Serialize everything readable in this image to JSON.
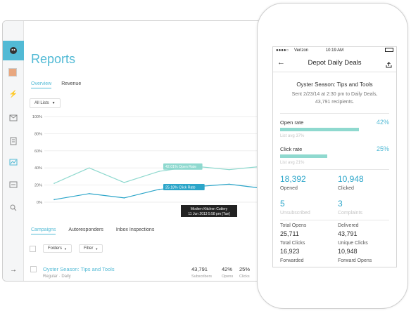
{
  "desktop": {
    "title": "Reports",
    "tabs": [
      "Overview",
      "Revenue"
    ],
    "list_filter": "All Lists",
    "sub_tabs": [
      "Campaigns",
      "Autoresponders",
      "Inbox Inspections"
    ],
    "folders_label": "Folders",
    "filter_label": "Filter",
    "campaign": {
      "name": "Oyster Season: Tips and Tools",
      "meta": "Regular · Daily",
      "subscribers": "43,791",
      "subscribers_label": "Subscribers",
      "opens": "42%",
      "opens_label": "Opens",
      "clicks": "25%",
      "clicks_label": "Clicks"
    }
  },
  "chart_data": {
    "type": "line",
    "y_ticks": [
      "100%",
      "80%",
      "60%",
      "40%",
      "20%",
      "0%"
    ],
    "ylim": [
      0,
      100
    ],
    "x": [
      1,
      2,
      3,
      4,
      5,
      6,
      7,
      8
    ],
    "series": [
      {
        "name": "Open Rate",
        "values": [
          22,
          40,
          23,
          36,
          42,
          38,
          42,
          42
        ]
      },
      {
        "name": "Click Rate",
        "values": [
          3,
          10,
          5,
          15,
          18,
          21,
          16,
          19
        ]
      }
    ],
    "annotations": {
      "open_label": "42.01% Open Rate",
      "click_label": "25.18% Click Rate",
      "tooltip_line1": "Modern Kitchen Cutlery",
      "tooltip_line2": "11 Jun 2013 5:58 pm [Tue]"
    },
    "colors": {
      "open": "#8fd9cf",
      "click": "#2ba5c9"
    }
  },
  "phone": {
    "status": {
      "carrier": "Verizon",
      "time": "10:19 AM"
    },
    "nav_title": "Depot Daily Deals",
    "campaign_title": "Oyster Season: Tips and Tools",
    "sent_line1": "Sent 2/23/14 at 2:30 pm to Daily Deals,",
    "sent_line2": "43,791 recipients.",
    "open_rate_label": "Open rate",
    "open_rate_value": "42%",
    "open_rate_fraction": 0.42,
    "open_avg": "List avg 37%",
    "click_rate_label": "Click rate",
    "click_rate_value": "25%",
    "click_rate_fraction": 0.25,
    "click_avg": "List avg 21%",
    "opened_value": "18,392",
    "opened_label": "Opened",
    "clicked_value": "10,948",
    "clicked_label": "Clicked",
    "unsub_value": "5",
    "unsub_label": "Unsubscribed",
    "complaints_value": "3",
    "complaints_label": "Complaints",
    "total_opens_label": "Total Opens",
    "total_opens_value": "25,711",
    "delivered_label": "Delivered",
    "delivered_value": "43,791",
    "total_clicks_label": "Total Clicks",
    "total_clicks_value": "16,923",
    "unique_clicks_label": "Unique Clicks",
    "unique_clicks_value": "10,948",
    "forwarded_label": "Forwarded",
    "forward_opens_label": "Forward Opens"
  }
}
